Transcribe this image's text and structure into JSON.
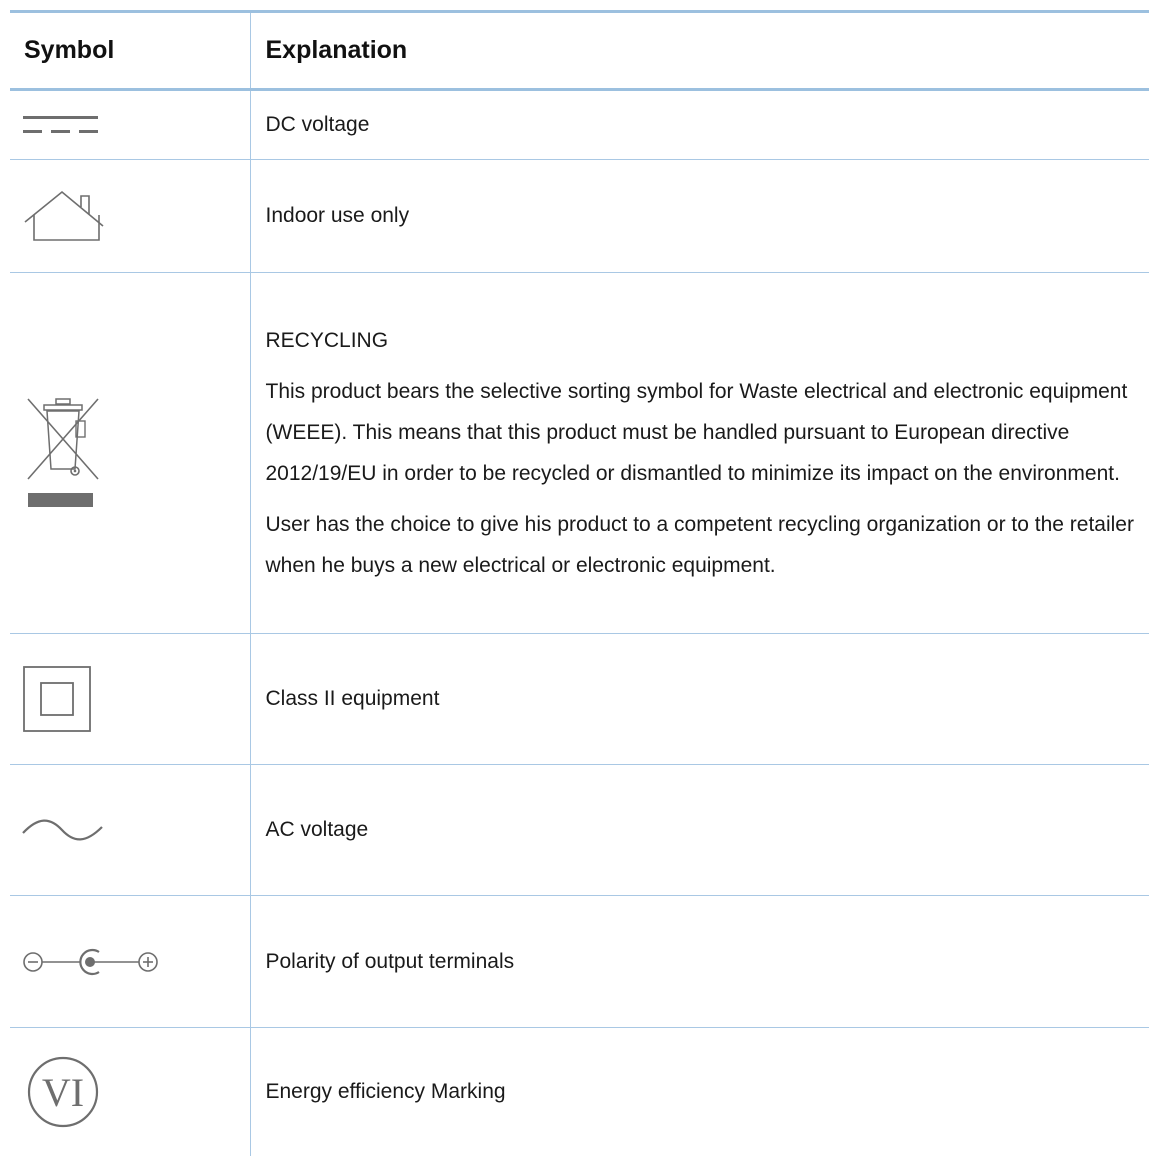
{
  "table": {
    "headers": {
      "symbol": "Symbol",
      "explanation": "Explanation"
    },
    "rows": [
      {
        "icon": "dc-voltage-icon",
        "explanation": "DC voltage"
      },
      {
        "icon": "house-icon",
        "explanation": "Indoor use only"
      },
      {
        "icon": "crossed-bin-icon",
        "heading": "RECYCLING",
        "paragraph_1": "This product bears the selective sorting symbol for Waste electrical and electronic equipment (WEEE). This means that this product must be handled pursuant to European directive 2012/19/EU in order to be recycled or dismantled to minimize its impact on the environment.",
        "paragraph_2": "User has the choice to give his product to a competent recycling organization or to the retailer when he buys a new electrical or electronic equipment."
      },
      {
        "icon": "class-ii-icon",
        "explanation": "Class II equipment"
      },
      {
        "icon": "ac-voltage-icon",
        "explanation": "AC voltage"
      },
      {
        "icon": "polarity-icon",
        "explanation": "Polarity of output terminals"
      },
      {
        "icon": "energy-efficiency-icon",
        "icon_text": "VI",
        "explanation": "Energy efficiency Marking"
      }
    ]
  },
  "colors": {
    "rule": "#9cc0df",
    "icon": "#6e6e6e",
    "text": "#1a1a1a"
  }
}
